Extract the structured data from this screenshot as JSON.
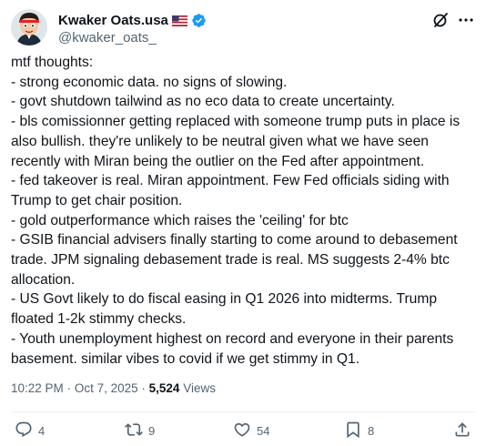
{
  "author": {
    "display_name": "Kwaker Oats.usa",
    "handle": "@kwaker_oats_",
    "flag_icon": "us-flag-icon",
    "verified_icon": "verified-badge-icon",
    "verified_color": "#1d9bf0"
  },
  "tweet": {
    "text": "mtf thoughts:\n- strong economic data. no signs of slowing.\n- govt shutdown tailwind as no eco data to create uncertainty.\n- bls comissionner getting replaced with someone trump puts in place is also bullish. they're unlikely to be neutral given what we have seen recently with Miran being the outlier on the Fed after appointment.\n- fed takeover is real. Miran appointment. Few Fed officials siding with Trump to get chair position.\n- gold outperformance which raises the 'ceiling' for btc\n- GSIB financial advisers finally starting to come around to debasement trade. JPM signaling debasement trade is real. MS suggests 2-4% btc allocation.\n- US Govt likely to do fiscal easing in Q1 2026 into midterms. Trump floated 1-2k stimmy checks.\n- Youth unemployment highest on record and everyone in their parents basement. similar vibes to covid if we get stimmy in Q1.",
    "time": "10:22 PM",
    "separator": "·",
    "date": "Oct 7, 2025",
    "views_count": "5,524",
    "views_label": "Views"
  },
  "actions": {
    "replies": "4",
    "reposts": "9",
    "likes": "54",
    "bookmarks": "8"
  },
  "colors": {
    "text": "#0f1419",
    "secondary": "#536471",
    "divider": "#eff3f4"
  }
}
